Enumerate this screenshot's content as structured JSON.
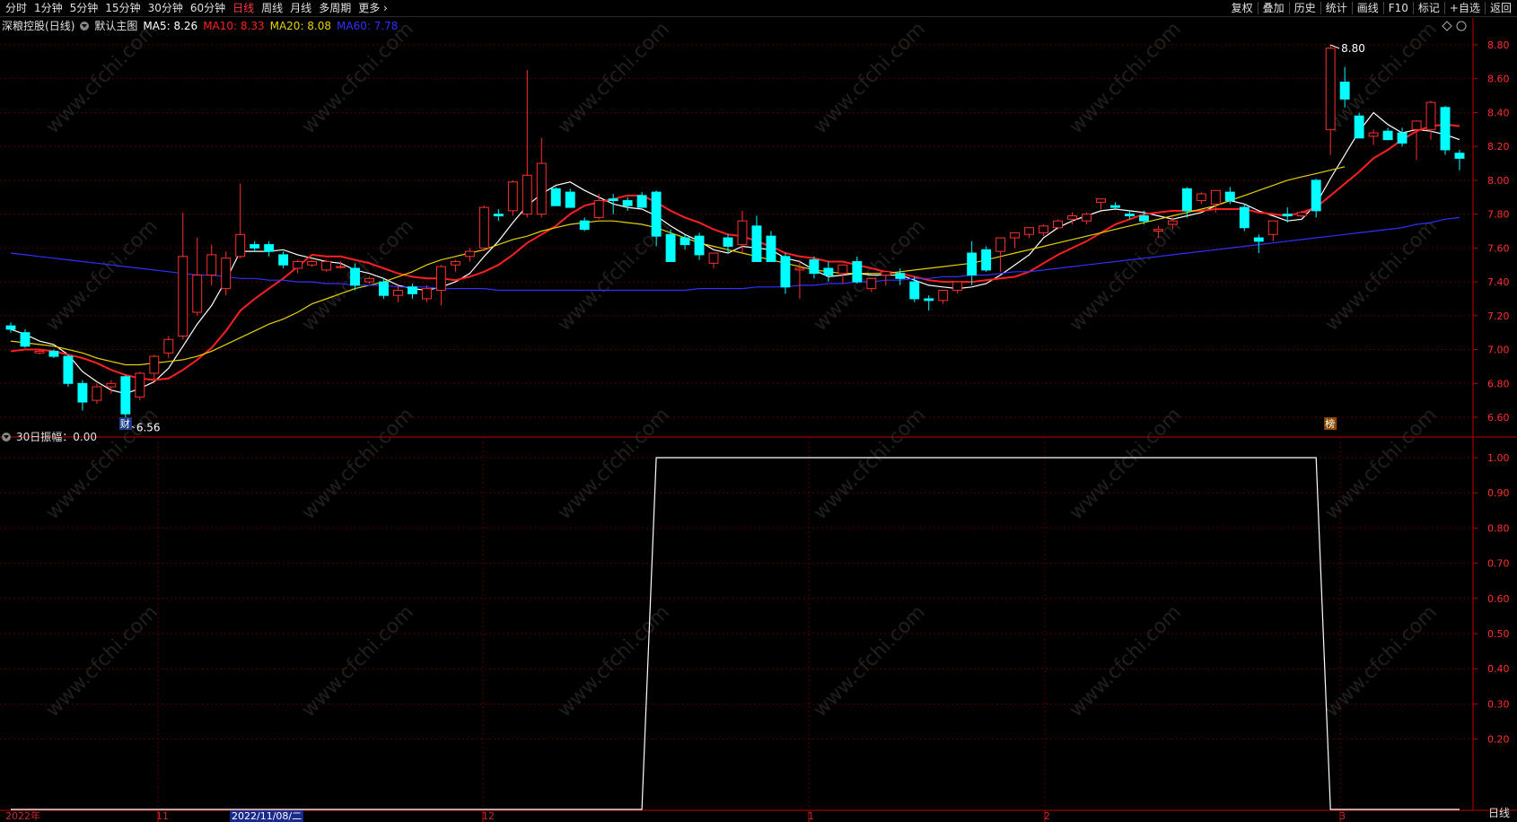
{
  "toolbar": {
    "periods": [
      "分时",
      "1分钟",
      "5分钟",
      "15分钟",
      "30分钟",
      "60分钟",
      "日线",
      "周线",
      "月线",
      "多周期",
      "更多 ›"
    ],
    "active_period": "日线",
    "right_items": [
      "复权",
      "叠加",
      "历史",
      "统计",
      "画线",
      "F10",
      "标记",
      "+自选",
      "返回"
    ]
  },
  "main_panel": {
    "stock_name": "深粮控股",
    "period_label": "(日线)",
    "template": "默认主图",
    "ma5": {
      "label": "MA5: 8.26",
      "color": "#ffffff"
    },
    "ma10": {
      "label": "MA10: 8.33",
      "color": "#ff2020"
    },
    "ma20": {
      "label": "MA20: 8.08",
      "color": "#e6d200"
    },
    "ma60": {
      "label": "MA60: 7.78",
      "color": "#3030ff"
    },
    "high_label": "8.80",
    "low_label": "6.56",
    "marker_cai": "财",
    "marker_bang": "榜"
  },
  "sub_panel": {
    "indicator": "30日振幅",
    "value_label": "30日振幅：0.00"
  },
  "dates": {
    "year": "2022年",
    "nov": "11",
    "cursor_date": "2022/11/08/二",
    "dec": "12",
    "jan": "1",
    "feb": "2",
    "mar": "3"
  },
  "period_badge": "日线",
  "colors": {
    "up": "#ff3030",
    "down": "#00ffff",
    "grid": "#5a0000",
    "axis": "#c00000"
  },
  "chart_data": [
    {
      "type": "candlestick",
      "title": "深粮控股 (日线)",
      "ylim": [
        6.5,
        8.95
      ],
      "yticks": [
        6.6,
        6.8,
        7.0,
        7.2,
        7.4,
        7.6,
        7.8,
        8.0,
        8.2,
        8.4,
        8.6,
        8.8
      ],
      "candles": [
        [
          7.14,
          7.16,
          7.1,
          7.12
        ],
        [
          7.1,
          7.12,
          7.01,
          7.02
        ],
        [
          6.98,
          7.0,
          6.97,
          6.99
        ],
        [
          6.99,
          7.0,
          6.95,
          6.96
        ],
        [
          6.96,
          6.97,
          6.78,
          6.8
        ],
        [
          6.8,
          6.82,
          6.64,
          6.69
        ],
        [
          6.7,
          6.8,
          6.68,
          6.78
        ],
        [
          6.78,
          6.82,
          6.74,
          6.8
        ],
        [
          6.84,
          6.85,
          6.56,
          6.62
        ],
        [
          6.72,
          6.87,
          6.7,
          6.86
        ],
        [
          6.86,
          6.97,
          6.81,
          6.96
        ],
        [
          6.98,
          7.08,
          6.95,
          7.06
        ],
        [
          7.08,
          7.81,
          7.06,
          7.55
        ],
        [
          7.22,
          7.66,
          7.2,
          7.44
        ],
        [
          7.44,
          7.62,
          7.38,
          7.56
        ],
        [
          7.36,
          7.58,
          7.32,
          7.54
        ],
        [
          7.55,
          7.98,
          7.54,
          7.68
        ],
        [
          7.62,
          7.64,
          7.58,
          7.6
        ],
        [
          7.62,
          7.64,
          7.55,
          7.58
        ],
        [
          7.56,
          7.58,
          7.48,
          7.5
        ],
        [
          7.48,
          7.53,
          7.45,
          7.52
        ],
        [
          7.5,
          7.53,
          7.49,
          7.52
        ],
        [
          7.47,
          7.53,
          7.46,
          7.52
        ],
        [
          7.49,
          7.52,
          7.48,
          7.49
        ],
        [
          7.48,
          7.51,
          7.35,
          7.38
        ],
        [
          7.4,
          7.43,
          7.39,
          7.42
        ],
        [
          7.4,
          7.42,
          7.3,
          7.32
        ],
        [
          7.32,
          7.38,
          7.28,
          7.35
        ],
        [
          7.37,
          7.39,
          7.3,
          7.33
        ],
        [
          7.3,
          7.38,
          7.28,
          7.36
        ],
        [
          7.35,
          7.5,
          7.26,
          7.49
        ],
        [
          7.5,
          7.53,
          7.46,
          7.52
        ],
        [
          7.55,
          7.6,
          7.52,
          7.58
        ],
        [
          7.6,
          7.85,
          7.58,
          7.84
        ],
        [
          7.8,
          7.83,
          7.76,
          7.79
        ],
        [
          7.82,
          8.0,
          7.79,
          7.99
        ],
        [
          7.8,
          8.65,
          7.78,
          8.03
        ],
        [
          7.8,
          8.25,
          7.78,
          8.1
        ],
        [
          7.95,
          7.96,
          7.85,
          7.85
        ],
        [
          7.93,
          7.95,
          7.84,
          7.84
        ],
        [
          7.76,
          7.78,
          7.7,
          7.71
        ],
        [
          7.78,
          7.92,
          7.77,
          7.88
        ],
        [
          7.89,
          7.92,
          7.8,
          7.88
        ],
        [
          7.88,
          7.9,
          7.82,
          7.85
        ],
        [
          7.91,
          7.93,
          7.84,
          7.84
        ],
        [
          7.93,
          7.94,
          7.61,
          7.67
        ],
        [
          7.68,
          7.71,
          7.52,
          7.52
        ],
        [
          7.66,
          7.68,
          7.59,
          7.62
        ],
        [
          7.67,
          7.69,
          7.53,
          7.56
        ],
        [
          7.51,
          7.53,
          7.48,
          7.57
        ],
        [
          7.66,
          7.68,
          7.57,
          7.61
        ],
        [
          7.62,
          7.82,
          7.57,
          7.76
        ],
        [
          7.73,
          7.79,
          7.52,
          7.52
        ],
        [
          7.67,
          7.7,
          7.52,
          7.52
        ],
        [
          7.55,
          7.57,
          7.33,
          7.37
        ],
        [
          7.47,
          7.53,
          7.3,
          7.48
        ],
        [
          7.53,
          7.55,
          7.42,
          7.45
        ],
        [
          7.48,
          7.52,
          7.4,
          7.44
        ],
        [
          7.45,
          7.49,
          7.39,
          7.5
        ],
        [
          7.52,
          7.55,
          7.39,
          7.4
        ],
        [
          7.36,
          7.4,
          7.34,
          7.42
        ],
        [
          7.44,
          7.46,
          7.38,
          7.46
        ],
        [
          7.45,
          7.48,
          7.38,
          7.42
        ],
        [
          7.4,
          7.43,
          7.28,
          7.3
        ],
        [
          7.3,
          7.32,
          7.23,
          7.29
        ],
        [
          7.29,
          7.34,
          7.27,
          7.35
        ],
        [
          7.35,
          7.39,
          7.33,
          7.4
        ],
        [
          7.57,
          7.64,
          7.38,
          7.44
        ],
        [
          7.59,
          7.61,
          7.46,
          7.47
        ],
        [
          7.58,
          7.62,
          7.46,
          7.66
        ],
        [
          7.66,
          7.68,
          7.6,
          7.69
        ],
        [
          7.68,
          7.72,
          7.66,
          7.72
        ],
        [
          7.69,
          7.74,
          7.67,
          7.73
        ],
        [
          7.72,
          7.77,
          7.71,
          7.76
        ],
        [
          7.77,
          7.81,
          7.74,
          7.79
        ],
        [
          7.76,
          7.81,
          7.74,
          7.8
        ],
        [
          7.87,
          7.89,
          7.83,
          7.89
        ],
        [
          7.85,
          7.87,
          7.83,
          7.84
        ],
        [
          7.8,
          7.82,
          7.77,
          7.79
        ],
        [
          7.79,
          7.82,
          7.74,
          7.76
        ],
        [
          7.7,
          7.73,
          7.66,
          7.71
        ],
        [
          7.74,
          7.78,
          7.71,
          7.76
        ],
        [
          7.95,
          7.96,
          7.78,
          7.82
        ],
        [
          7.88,
          7.93,
          7.86,
          7.92
        ],
        [
          7.86,
          7.91,
          7.81,
          7.94
        ],
        [
          7.93,
          7.96,
          7.86,
          7.88
        ],
        [
          7.84,
          7.86,
          7.7,
          7.72
        ],
        [
          7.66,
          7.68,
          7.57,
          7.64
        ],
        [
          7.68,
          7.75,
          7.64,
          7.76
        ],
        [
          7.8,
          7.84,
          7.75,
          7.79
        ],
        [
          7.79,
          7.82,
          7.78,
          7.81
        ],
        [
          8.0,
          8.01,
          7.78,
          7.82
        ],
        [
          8.3,
          8.8,
          8.15,
          8.78
        ],
        [
          8.58,
          8.67,
          8.43,
          8.48
        ],
        [
          8.38,
          8.4,
          8.26,
          8.25
        ],
        [
          8.26,
          8.3,
          8.21,
          8.28
        ],
        [
          8.29,
          8.31,
          8.24,
          8.24
        ],
        [
          8.28,
          8.31,
          8.2,
          8.22
        ],
        [
          8.3,
          8.35,
          8.12,
          8.35
        ],
        [
          8.3,
          8.47,
          8.24,
          8.46
        ],
        [
          8.43,
          8.44,
          8.15,
          8.18
        ],
        [
          8.16,
          8.18,
          8.06,
          8.13
        ]
      ],
      "series": [
        {
          "name": "MA5",
          "color": "#ffffff",
          "values": [
            7.12,
            7.09,
            7.05,
            7.03,
            6.97,
            6.87,
            6.81,
            6.76,
            6.74,
            6.77,
            6.81,
            6.89,
            7.02,
            7.15,
            7.26,
            7.41,
            7.58,
            7.58,
            7.58,
            7.59,
            7.56,
            7.54,
            7.52,
            7.51,
            7.47,
            7.45,
            7.42,
            7.38,
            7.36,
            7.35,
            7.37,
            7.4,
            7.45,
            7.55,
            7.64,
            7.75,
            7.85,
            7.92,
            7.97,
            7.99,
            7.94,
            7.9,
            7.86,
            7.84,
            7.83,
            7.79,
            7.73,
            7.68,
            7.64,
            7.59,
            7.57,
            7.61,
            7.6,
            7.59,
            7.54,
            7.52,
            7.47,
            7.43,
            7.44,
            7.45,
            7.44,
            7.44,
            7.44,
            7.41,
            7.38,
            7.37,
            7.36,
            7.37,
            7.39,
            7.44,
            7.5,
            7.56,
            7.66,
            7.72,
            7.76,
            7.79,
            7.82,
            7.83,
            7.82,
            7.81,
            7.79,
            7.77,
            7.79,
            7.81,
            7.85,
            7.88,
            7.86,
            7.82,
            7.79,
            7.76,
            7.77,
            7.86,
            8.01,
            8.15,
            8.29,
            8.4,
            8.33,
            8.28,
            8.3,
            8.29,
            8.27,
            8.24
          ]
        },
        {
          "name": "MA10",
          "color": "#ff2020",
          "values": [
            6.99,
            7.0,
            7.0,
            6.99,
            6.97,
            6.95,
            6.92,
            6.88,
            6.85,
            6.83,
            6.82,
            6.83,
            6.88,
            6.94,
            7.01,
            7.11,
            7.23,
            7.3,
            7.36,
            7.42,
            7.49,
            7.56,
            7.55,
            7.55,
            7.53,
            7.51,
            7.48,
            7.45,
            7.43,
            7.42,
            7.42,
            7.41,
            7.43,
            7.46,
            7.5,
            7.56,
            7.63,
            7.68,
            7.73,
            7.8,
            7.85,
            7.87,
            7.89,
            7.91,
            7.91,
            7.87,
            7.82,
            7.78,
            7.75,
            7.71,
            7.68,
            7.67,
            7.64,
            7.61,
            7.57,
            7.55,
            7.54,
            7.52,
            7.52,
            7.5,
            7.48,
            7.46,
            7.45,
            7.43,
            7.41,
            7.4,
            7.4,
            7.4,
            7.41,
            7.42,
            7.43,
            7.46,
            7.51,
            7.56,
            7.6,
            7.64,
            7.69,
            7.74,
            7.77,
            7.8,
            7.81,
            7.82,
            7.82,
            7.82,
            7.83,
            7.83,
            7.83,
            7.81,
            7.8,
            7.79,
            7.81,
            7.84,
            7.91,
            7.98,
            8.05,
            8.13,
            8.18,
            8.24,
            8.29,
            8.32,
            8.33,
            8.32
          ]
        },
        {
          "name": "MA20",
          "color": "#e6d200",
          "values": [
            7.05,
            7.04,
            7.03,
            7.02,
            7.0,
            6.98,
            6.95,
            6.93,
            6.91,
            6.91,
            6.92,
            6.93,
            6.94,
            6.96,
            6.99,
            7.03,
            7.07,
            7.11,
            7.15,
            7.18,
            7.22,
            7.27,
            7.3,
            7.33,
            7.36,
            7.38,
            7.4,
            7.43,
            7.46,
            7.5,
            7.53,
            7.55,
            7.57,
            7.59,
            7.62,
            7.65,
            7.67,
            7.7,
            7.72,
            7.74,
            7.75,
            7.76,
            7.76,
            7.75,
            7.74,
            7.72,
            7.69,
            7.66,
            7.63,
            7.61,
            7.59,
            7.57,
            7.55,
            7.53,
            7.51,
            7.49,
            7.47,
            7.46,
            7.45,
            7.45,
            7.45,
            7.45,
            7.46,
            7.47,
            7.48,
            7.49,
            7.5,
            7.51,
            7.53,
            7.55,
            7.57,
            7.59,
            7.61,
            7.63,
            7.65,
            7.67,
            7.69,
            7.71,
            7.73,
            7.75,
            7.77,
            7.79,
            7.81,
            7.83,
            7.85,
            7.88,
            7.91,
            7.94,
            7.97,
            8.0,
            8.02,
            8.04,
            8.06,
            8.08
          ]
        },
        {
          "name": "MA60",
          "color": "#3030ff",
          "values": [
            7.57,
            7.56,
            7.55,
            7.54,
            7.53,
            7.52,
            7.51,
            7.5,
            7.49,
            7.48,
            7.47,
            7.46,
            7.45,
            7.44,
            7.44,
            7.43,
            7.42,
            7.42,
            7.41,
            7.41,
            7.4,
            7.4,
            7.39,
            7.39,
            7.38,
            7.38,
            7.38,
            7.37,
            7.37,
            7.37,
            7.36,
            7.36,
            7.36,
            7.36,
            7.35,
            7.35,
            7.35,
            7.35,
            7.35,
            7.35,
            7.35,
            7.35,
            7.35,
            7.35,
            7.35,
            7.35,
            7.35,
            7.35,
            7.36,
            7.36,
            7.36,
            7.36,
            7.37,
            7.37,
            7.37,
            7.38,
            7.38,
            7.39,
            7.39,
            7.4,
            7.4,
            7.41,
            7.41,
            7.42,
            7.42,
            7.43,
            7.43,
            7.44,
            7.44,
            7.45,
            7.46,
            7.46,
            7.47,
            7.48,
            7.49,
            7.5,
            7.51,
            7.52,
            7.53,
            7.54,
            7.55,
            7.56,
            7.57,
            7.58,
            7.59,
            7.6,
            7.61,
            7.62,
            7.63,
            7.64,
            7.65,
            7.66,
            7.67,
            7.68,
            7.69,
            7.7,
            7.71,
            7.72,
            7.74,
            7.75,
            7.77,
            7.78
          ]
        }
      ]
    },
    {
      "type": "line",
      "title": "30日振幅",
      "ylim": [
        0,
        1.05
      ],
      "yticks": [
        0.2,
        0.3,
        0.4,
        0.5,
        0.6,
        0.7,
        0.8,
        0.9,
        1.0
      ],
      "series": [
        {
          "name": "30日振幅",
          "color": "#ffffff",
          "values": [
            0,
            0,
            0,
            0,
            0,
            0,
            0,
            0,
            0,
            0,
            0,
            0,
            0,
            0,
            0,
            0,
            0,
            0,
            0,
            0,
            0,
            0,
            0,
            0,
            0,
            0,
            0,
            0,
            0,
            0,
            0,
            0,
            0,
            0,
            0,
            0,
            0,
            0,
            0,
            0,
            0,
            0,
            0,
            0,
            0,
            1,
            1,
            1,
            1,
            1,
            1,
            1,
            1,
            1,
            1,
            1,
            1,
            1,
            1,
            1,
            1,
            1,
            1,
            1,
            1,
            1,
            1,
            1,
            1,
            1,
            1,
            1,
            1,
            1,
            1,
            1,
            1,
            1,
            1,
            1,
            1,
            1,
            1,
            1,
            1,
            1,
            1,
            1,
            1,
            1,
            1,
            1,
            0,
            0,
            0,
            0,
            0,
            0,
            0,
            0,
            0,
            0
          ]
        }
      ]
    }
  ]
}
